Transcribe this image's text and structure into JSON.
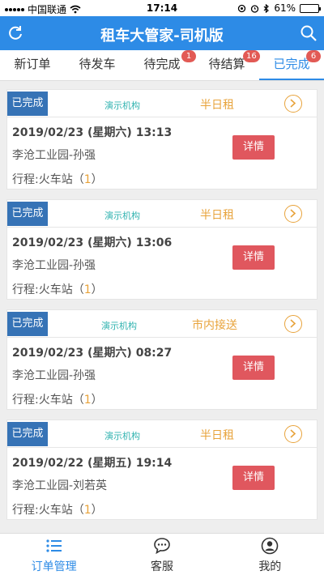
{
  "status_bar": {
    "carrier": "中国联通",
    "time": "17:14",
    "battery": "61%",
    "battery_level": 0.61
  },
  "header": {
    "title": "租车大管家-司机版"
  },
  "tabs": [
    {
      "label": "新订单",
      "badge": ""
    },
    {
      "label": "待发车",
      "badge": ""
    },
    {
      "label": "待完成",
      "badge": "1"
    },
    {
      "label": "待结算",
      "badge": "16"
    },
    {
      "label": "已完成",
      "badge": "6"
    }
  ],
  "orders": [
    {
      "status": "已完成",
      "org": "演示机构",
      "type": "半日租",
      "datetime": "2019/02/23 (星期六) 13:13",
      "route": "李沧工业园-孙强",
      "trip_label": "行程:火车站",
      "trip_count": "1",
      "detail_label": "详情"
    },
    {
      "status": "已完成",
      "org": "演示机构",
      "type": "半日租",
      "datetime": "2019/02/23 (星期六) 13:06",
      "route": "李沧工业园-孙强",
      "trip_label": "行程:火车站",
      "trip_count": "1",
      "detail_label": "详情"
    },
    {
      "status": "已完成",
      "org": "演示机构",
      "type": "市内接送",
      "datetime": "2019/02/23 (星期六) 08:27",
      "route": "李沧工业园-孙强",
      "trip_label": "行程:火车站",
      "trip_count": "1",
      "detail_label": "详情"
    },
    {
      "status": "已完成",
      "org": "演示机构",
      "type": "半日租",
      "datetime": "2019/02/22 (星期五) 19:14",
      "route": "李沧工业园-刘若英",
      "trip_label": "行程:火车站",
      "trip_count": "1",
      "detail_label": "详情"
    }
  ],
  "bottom_nav": [
    {
      "label": "订单管理",
      "icon": "list-icon"
    },
    {
      "label": "客服",
      "icon": "chat-icon"
    },
    {
      "label": "我的",
      "icon": "user-icon"
    }
  ],
  "colors": {
    "primary": "#2d8be6",
    "status_tag": "#3673b6",
    "accent_orange": "#e8a33b",
    "detail_red": "#e0575e",
    "badge_red": "#e25a55",
    "org_teal": "#31b3b0"
  }
}
